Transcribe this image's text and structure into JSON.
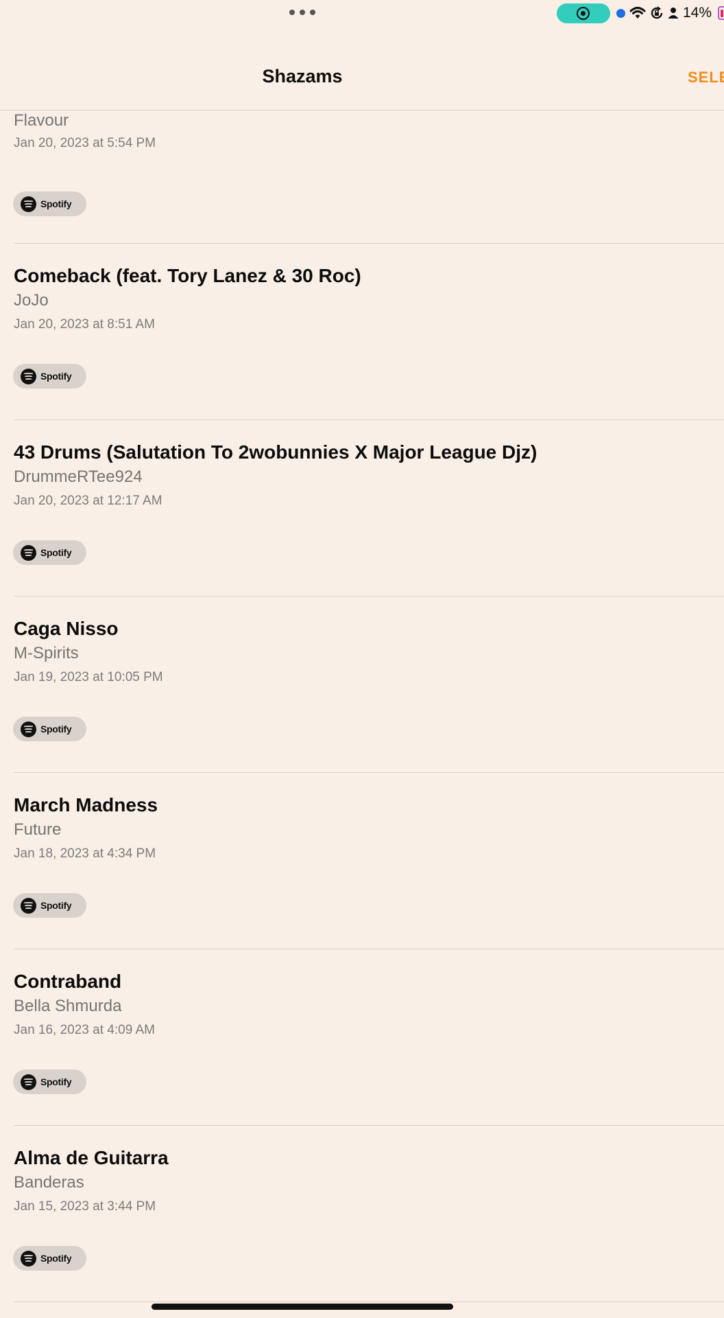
{
  "status_bar": {
    "battery_percent": "14%",
    "icons": [
      "more-dots-icon",
      "screen-record-icon",
      "camera-indicator-icon",
      "wifi-icon",
      "rotation-lock-icon",
      "person-icon",
      "battery-icon"
    ],
    "colors": {
      "record_pill": "#33cdbd",
      "camera_dot": "#1f6fe0"
    }
  },
  "nav": {
    "title": "Shazams",
    "select_label": "SELE"
  },
  "colors": {
    "background": "#f9efe6",
    "accent": "#f28b1a",
    "badge": "#d9d2cc"
  },
  "items": [
    {
      "song": "",
      "artist": "Flavour",
      "date": "Jan 20, 2023 at 5:54 PM",
      "badge": "Spotify"
    },
    {
      "song": "Comeback (feat. Tory Lanez & 30 Roc)",
      "artist": "JoJo",
      "date": "Jan 20, 2023 at 8:51 AM",
      "badge": "Spotify"
    },
    {
      "song": "43 Drums (Salutation To 2wobunnies X Major League Djz)",
      "artist": "DrummeRTee924",
      "date": "Jan 20, 2023 at 12:17 AM",
      "badge": "Spotify"
    },
    {
      "song": "Caga Nisso",
      "artist": "M-Spirits",
      "date": "Jan 19, 2023 at 10:05 PM",
      "badge": "Spotify"
    },
    {
      "song": "March Madness",
      "artist": "Future",
      "date": "Jan 18, 2023 at 4:34 PM",
      "badge": "Spotify"
    },
    {
      "song": "Contraband",
      "artist": "Bella Shmurda",
      "date": "Jan 16, 2023 at 4:09 AM",
      "badge": "Spotify"
    },
    {
      "song": "Alma de Guitarra",
      "artist": "Banderas",
      "date": "Jan 15, 2023 at 3:44 PM",
      "badge": "Spotify"
    }
  ]
}
